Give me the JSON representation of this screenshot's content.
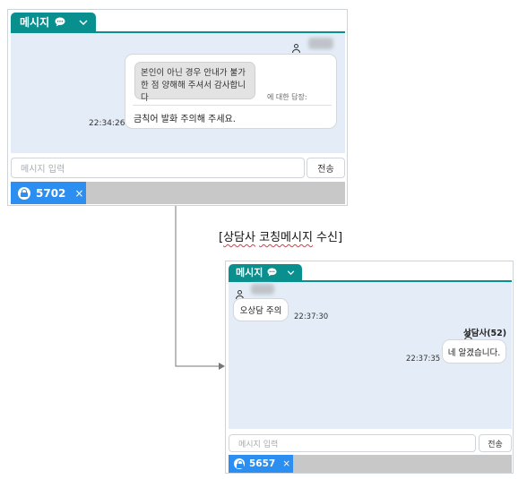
{
  "colors": {
    "accent": "#0a8f8f",
    "chat_bg": "#e4edf7",
    "chip": "#2c8ef0",
    "bar": "#c8c8c8"
  },
  "panel1": {
    "tab_label": "메시지",
    "chat_icon": "speech-bubble-icon",
    "chevron_icon": "chevron-down-icon",
    "quote_text": "본인이 아닌 경우 안내가 불가한 점 양해해 주셔서 감사합니다",
    "reply_to_label": "에 대한 답장:",
    "message": "금칙어 발화 주의해 주세요.",
    "time": "22:34:26",
    "input_placeholder": "메시지 입력",
    "send_label": "전송",
    "chip_number": "5702",
    "chip_close": "×"
  },
  "caption": {
    "prefix": "[",
    "word1": "상담사",
    "word2": "코칭메시지",
    "rest": " 수신]"
  },
  "panel2": {
    "tab_label": "메시지",
    "chat_icon": "speech-bubble-icon",
    "chevron_icon": "chevron-down-icon",
    "msg_in": "오상담 주의",
    "time_in": "22:37:30",
    "agent_name": "상담사(52)",
    "msg_out": "네 알겠습니다.",
    "time_out": "22:37:35",
    "input_placeholder": "메시지 입력",
    "send_label": "전송",
    "chip_number": "5657",
    "chip_close": "×"
  }
}
